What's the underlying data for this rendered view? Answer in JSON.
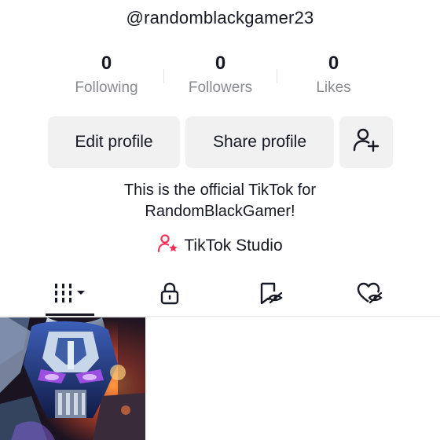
{
  "profile": {
    "username": "@randomblackgamer23",
    "bio_line1": "This is the official TikTok for",
    "bio_line2": "RandomBlackGamer!"
  },
  "stats": [
    {
      "value": "0",
      "label": "Following"
    },
    {
      "value": "0",
      "label": "Followers"
    },
    {
      "value": "0",
      "label": "Likes"
    }
  ],
  "actions": {
    "edit_label": "Edit profile",
    "share_label": "Share profile",
    "add_friend_icon": "add-person-icon"
  },
  "studio": {
    "label": "TikTok Studio",
    "icon": "studio-person-star-icon",
    "icon_color": "#fe2c55"
  },
  "tabs": [
    {
      "name": "videos",
      "icon": "grid-icon",
      "active": true
    },
    {
      "name": "private",
      "icon": "lock-icon",
      "active": false
    },
    {
      "name": "favorites",
      "icon": "bookmark-hidden-icon",
      "active": false
    },
    {
      "name": "liked",
      "icon": "heart-hidden-icon",
      "active": false
    }
  ],
  "colors": {
    "text": "#161823",
    "secondary_text": "#8a8b91",
    "button_bg": "#f1f1f2",
    "accent": "#fe2c55"
  }
}
